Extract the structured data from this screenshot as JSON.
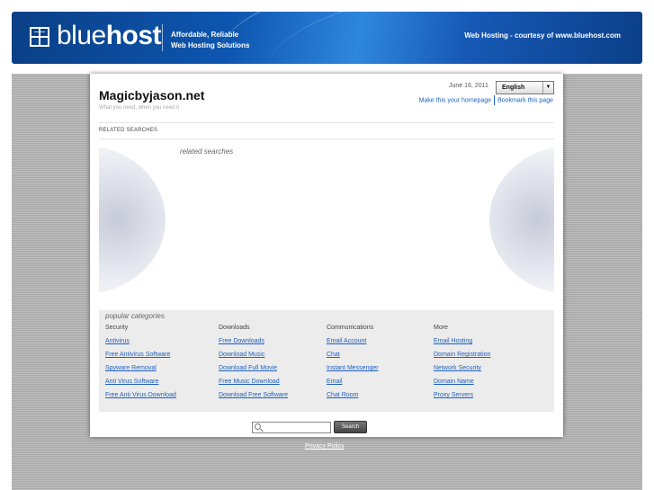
{
  "header": {
    "logo_light": "blue",
    "logo_bold": "host",
    "tagline_line1": "Affordable, Reliable",
    "tagline_line2": "Web Hosting Solutions",
    "courtesy": "Web Hosting - courtesy of www.bluehost.com",
    "icon": "grid-logo-icon"
  },
  "site": {
    "title": "Magicbyjason.net",
    "subtitle": "What you need, when you need it",
    "date": "June 16, 2011",
    "language": "English",
    "make_homepage": "Make this your homepage",
    "bookmark": "Bookmark this page"
  },
  "related": {
    "heading": "RELATED SEARCHES",
    "label": "related searches"
  },
  "categories": {
    "heading": "popular categories",
    "columns": [
      {
        "title": "Security",
        "links": [
          "Antivirus",
          "Free Antivirus Software",
          "Spyware Removal",
          "Anti Virus Software",
          "Free Anti Virus Download"
        ]
      },
      {
        "title": "Downloads",
        "links": [
          "Free Downloads",
          "Download Music",
          "Download Full Movie",
          "Free Music Download",
          "Download Free Software"
        ]
      },
      {
        "title": "Communications",
        "links": [
          "Email Account",
          "Chat",
          "Instant Messenger",
          "Email",
          "Chat Room"
        ]
      },
      {
        "title": "More",
        "links": [
          "Email Hosting",
          "Domain Registration",
          "Network Security",
          "Domain Name",
          "Proxy Servers"
        ]
      }
    ]
  },
  "search": {
    "value": "",
    "button": "Search",
    "icon": "magnifier-icon"
  },
  "footer": {
    "privacy": "Privacy Policy"
  },
  "colors": {
    "brand_blue": "#0d56b0",
    "link": "#1e5fbf"
  }
}
